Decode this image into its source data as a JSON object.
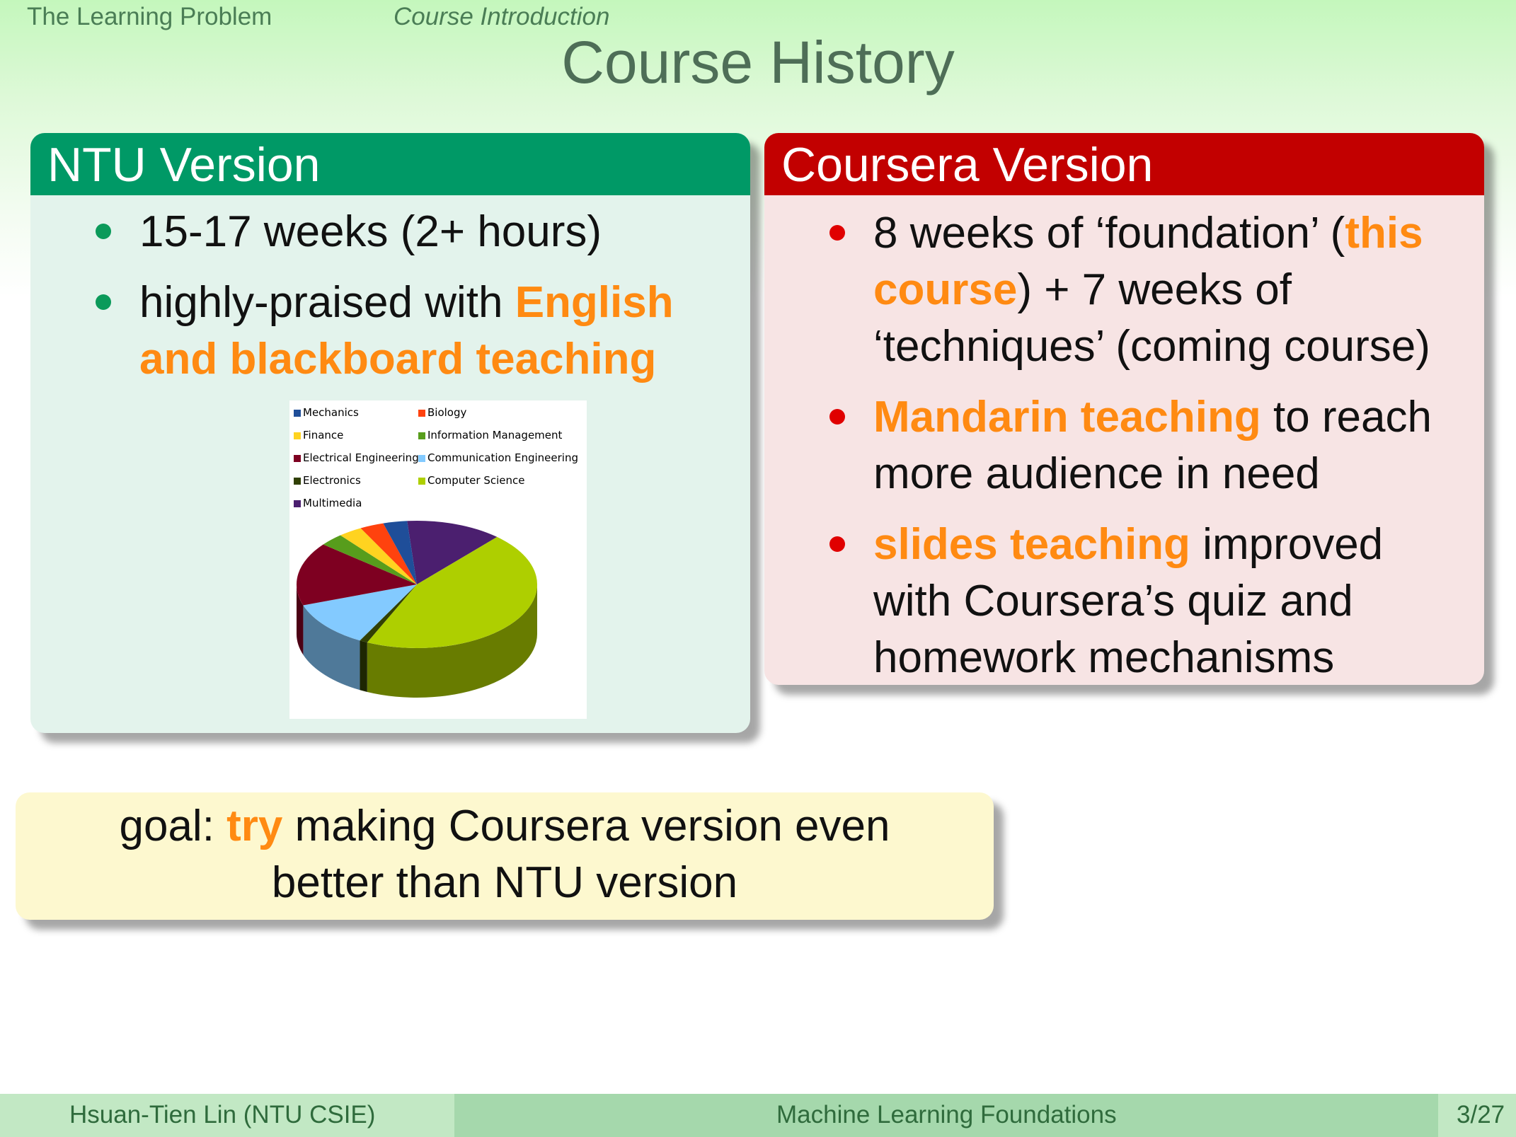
{
  "header": {
    "section": "The Learning Problem",
    "subsection": "Course Introduction"
  },
  "title": "Course History",
  "ntu": {
    "heading": "NTU Version",
    "item1": "15-17 weeks (2+ hours)",
    "item2_pre": "highly-praised with ",
    "item2_hl": "English and blackboard teaching"
  },
  "coursera": {
    "heading": "Coursera Version",
    "item1_a": "8 weeks of ‘foundation’ (",
    "item1_hl": "this course",
    "item1_b": ") + 7 weeks of ‘techniques’ (coming course)",
    "item2_hl": "Mandarin teaching",
    "item2_b": " to reach more audience in need",
    "item3_hl": "slides teaching",
    "item3_b": " improved with Coursera’s quiz and homework mechanisms"
  },
  "goal": {
    "pre": "goal: ",
    "hl": "try",
    "post": " making Coursera version even better than NTU version"
  },
  "footer": {
    "author": "Hsuan-Tien Lin  (NTU CSIE)",
    "course": "Machine Learning Foundations",
    "page": "3/27"
  },
  "chart_data": {
    "type": "pie",
    "categories": [
      "Mechanics",
      "Biology",
      "Finance",
      "Information Management",
      "Electrical Engineering",
      "Communication Engineering",
      "Electronics",
      "Computer Science",
      "Multimedia"
    ],
    "values": [
      3,
      3,
      3,
      3,
      15,
      11,
      1,
      42,
      12
    ],
    "colors": [
      "#1f4e99",
      "#ff420e",
      "#ffd320",
      "#579d1c",
      "#7e0021",
      "#83caff",
      "#314004",
      "#aecf00",
      "#4b1f6f"
    ],
    "legend": "top"
  }
}
